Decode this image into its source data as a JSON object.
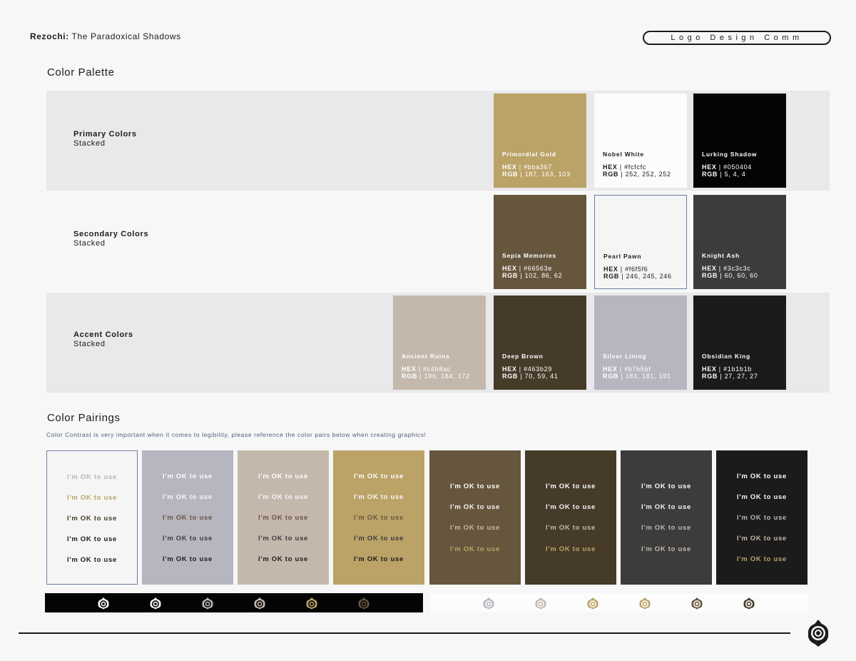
{
  "header": {
    "brand_bold": "Rezochi:",
    "brand_rest": " The Paradoxical Shadows",
    "pill": "Logo Design Comm"
  },
  "palette": {
    "title": "Color Palette",
    "primary": {
      "title": "Primary Colors",
      "subtitle": "Stacked",
      "swatches": [
        {
          "name": "Primordial Gold",
          "hex": "#bba367",
          "rgb": "187, 163, 103",
          "text": "#ffffff"
        },
        {
          "name": "Nobel White",
          "hex": "#fcfcfc",
          "rgb": "252, 252, 252",
          "text": "#1b1b1b"
        },
        {
          "name": "Lurking Shadow",
          "hex": "#050404",
          "rgb": "5, 4, 4",
          "text": "#ffffff"
        }
      ]
    },
    "secondary": {
      "title": "Secondary Colors",
      "subtitle": "Stacked",
      "swatches": [
        {
          "name": "Sepia Memories",
          "hex": "#66563e",
          "rgb": "102, 86, 62",
          "text": "#ffffff"
        },
        {
          "name": "Pearl Pawn",
          "hex": "#f6f5f6",
          "rgb": "246, 245, 246",
          "text": "#1b1b1b"
        },
        {
          "name": "Knight Ash",
          "hex": "#3c3c3c",
          "rgb": "60, 60, 60",
          "text": "#ffffff"
        }
      ]
    },
    "accent": {
      "title": "Accent Colors",
      "subtitle": "Stacked",
      "swatches": [
        {
          "name": "Ancient Ruins",
          "hex": "#c4b8ac",
          "rgb": "196, 184, 172",
          "text": "#ffffff"
        },
        {
          "name": "Deep Brown",
          "hex": "#463b29",
          "rgb": "70, 59, 41",
          "text": "#ffffff"
        },
        {
          "name": "Silver Lining",
          "hex": "#b7b5bf",
          "rgb": "183, 181, 191",
          "text": "#ffffff"
        },
        {
          "name": "Obsidian King",
          "hex": "#1b1b1b",
          "rgb": "27, 27, 27",
          "text": "#ffffff"
        }
      ]
    },
    "hex_label": "HEX",
    "rgb_label": "RGB",
    "sep": " | "
  },
  "pairings": {
    "title": "Color Pairings",
    "note": "Color Contrast is very important when it comes to legibility, please reference the color pairs below when creating graphics!",
    "ok_text": "I'm OK to use",
    "columns": [
      {
        "bg": "#f6f5f6",
        "border": "#6a7fa0",
        "texts": [
          "#b7b5bf",
          "#bba367",
          "#463b29",
          "#1b1b1b",
          "#1b1b1b"
        ]
      },
      {
        "bg": "#b7b5bf",
        "texts": [
          "#fcfcfc",
          "#f6f5f6",
          "#66563e",
          "#3c3c3c",
          "#1b1b1b"
        ]
      },
      {
        "bg": "#c4b8ac",
        "texts": [
          "#fcfcfc",
          "#f6f5f6",
          "#66563e",
          "#3c3c3c",
          "#1b1b1b"
        ]
      },
      {
        "bg": "#bba367",
        "texts": [
          "#fcfcfc",
          "#f6f5f6",
          "#66563e",
          "#3c3c3c",
          "#1b1b1b"
        ]
      },
      {
        "bg": "#66563e",
        "texts": [
          "#fcfcfc",
          "#f6f5f6",
          "#c4b8ac",
          "#bba367"
        ]
      },
      {
        "bg": "#463b29",
        "texts": [
          "#fcfcfc",
          "#f6f5f6",
          "#c4b8ac",
          "#bba367"
        ]
      },
      {
        "bg": "#3c3c3c",
        "texts": [
          "#fcfcfc",
          "#f6f5f6",
          "#b7b5bf",
          "#c4b8ac"
        ]
      },
      {
        "bg": "#1b1b1b",
        "texts": [
          "#fcfcfc",
          "#f6f5f6",
          "#b7b5bf",
          "#c4b8ac",
          "#bba367"
        ]
      }
    ]
  },
  "logo_strips": {
    "dark": [
      "#fcfcfc",
      "#f6f5f6",
      "#b7b5bf",
      "#c4b8ac",
      "#bba367",
      "#66563e"
    ],
    "light": [
      "#b7b5bf",
      "#c4b8ac",
      "#bba367",
      "#bba367",
      "#66563e",
      "#463b29"
    ]
  }
}
